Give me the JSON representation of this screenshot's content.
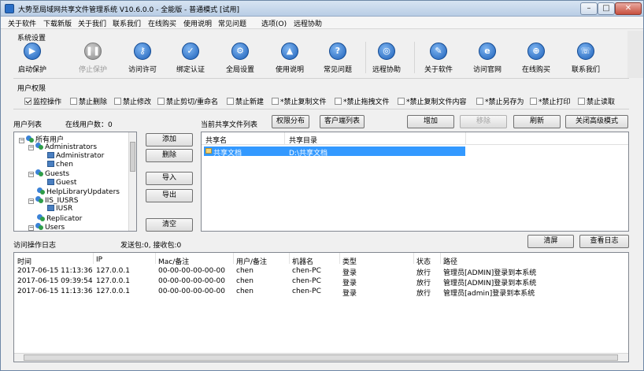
{
  "window": {
    "title": "大势至局域网共享文件管理系统 V10.6.0.0 - 全能版 - 普通模式 [试用]"
  },
  "menu": [
    "关于软件",
    "下载新版",
    "关于我们",
    "联系我们",
    "在线购买",
    "使用说明",
    "常见问题",
    "选项(O)",
    "远程协助"
  ],
  "system_settings": {
    "label": "系统设置",
    "buttons": [
      {
        "label": "启动保护",
        "icon": "play-icon",
        "glyph": "▶",
        "disabled": false
      },
      {
        "label": "停止保护",
        "icon": "pause-icon",
        "glyph": "❚❚",
        "disabled": true
      },
      {
        "label": "访问许可",
        "icon": "key-icon",
        "glyph": "⚷",
        "disabled": false
      },
      {
        "label": "绑定认证",
        "icon": "lock-icon",
        "glyph": "✓",
        "disabled": false
      },
      {
        "label": "全局设置",
        "icon": "gear-icon",
        "glyph": "⚙",
        "disabled": false
      },
      {
        "label": "使用说明",
        "icon": "graduation-cap-icon",
        "glyph": "▲",
        "disabled": false
      },
      {
        "label": "常见问题",
        "icon": "help-icon",
        "glyph": "?",
        "disabled": false
      },
      {
        "label": "远程协助",
        "icon": "remote-assist-icon",
        "glyph": "◎",
        "disabled": false
      },
      {
        "label": "关于软件",
        "icon": "wrench-icon",
        "glyph": "✎",
        "disabled": false
      },
      {
        "label": "访问官网",
        "icon": "browser-icon",
        "glyph": "e",
        "disabled": false
      },
      {
        "label": "在线购买",
        "icon": "cart-icon",
        "glyph": "⊕",
        "disabled": false
      },
      {
        "label": "联系我们",
        "icon": "contact-icon",
        "glyph": "☏",
        "disabled": false
      }
    ]
  },
  "user_permissions": {
    "label": "用户权限",
    "items": [
      {
        "label": "监控操作",
        "checked": true
      },
      {
        "label": "禁止删除",
        "checked": false
      },
      {
        "label": "禁止修改",
        "checked": false
      },
      {
        "label": "禁止剪切/重命名",
        "checked": false
      },
      {
        "label": "禁止新建",
        "checked": false
      },
      {
        "label": "*禁止复制文件",
        "checked": false
      },
      {
        "label": "*禁止拖拽文件",
        "checked": false
      },
      {
        "label": "*禁止复制文件内容",
        "checked": false
      },
      {
        "label": "*禁止另存为",
        "checked": false
      },
      {
        "label": "*禁止打印",
        "checked": false
      },
      {
        "label": "禁止读取",
        "checked": false
      }
    ]
  },
  "user_list": {
    "label": "用户列表",
    "online_label": "在线用户数：0",
    "tree": [
      {
        "label": "所有用户",
        "kind": "group",
        "expander": "−"
      },
      {
        "label": "Administrators",
        "kind": "group",
        "expander": "−"
      },
      {
        "label": "Administrator",
        "kind": "user"
      },
      {
        "label": "chen",
        "kind": "user"
      },
      {
        "label": "Guests",
        "kind": "group",
        "expander": "−"
      },
      {
        "label": "Guest",
        "kind": "user"
      },
      {
        "label": "HelpLibraryUpdaters",
        "kind": "group"
      },
      {
        "label": "IIS_IUSRS",
        "kind": "group",
        "expander": "−"
      },
      {
        "label": "IUSR",
        "kind": "user"
      },
      {
        "label": "Replicator",
        "kind": "group"
      },
      {
        "label": "Users",
        "kind": "group",
        "expander": "−"
      }
    ],
    "buttons": {
      "add": "添加",
      "delete": "删除",
      "import": "导入",
      "export": "导出",
      "clear": "清空"
    }
  },
  "shares": {
    "label": "当前共享文件列表",
    "buttons": {
      "perm_dist": "权限分布",
      "client_list": "客户端列表",
      "add": "增加",
      "remove": "移除",
      "refresh": "刷新",
      "close_adv": "关闭高级模式"
    },
    "columns": [
      "共享名",
      "共享目录"
    ],
    "rows": [
      {
        "name": "共享文档",
        "path": "D:\\共享文档"
      }
    ]
  },
  "log": {
    "label": "访问操作日志",
    "packets": "发送包:0, 接收包:0",
    "buttons": {
      "clear": "清屏",
      "view": "查看日志"
    },
    "columns": [
      "时间",
      "IP",
      "Mac/备注",
      "用户/备注",
      "机器名",
      "类型",
      "状态",
      "路径"
    ],
    "rows": [
      [
        "2017-06-15 11:13:36",
        "127.0.0.1",
        "00-00-00-00-00-00",
        "chen",
        "chen-PC",
        "登录",
        "放行",
        "管理员[ADMIN]登录到本系统"
      ],
      [
        "2017-06-15 09:39:54",
        "127.0.0.1",
        "00-00-00-00-00-00",
        "chen",
        "chen-PC",
        "登录",
        "放行",
        "管理员[ADMIN]登录到本系统"
      ],
      [
        "2017-06-15 11:13:36",
        "127.0.0.1",
        "00-00-00-00-00-00",
        "chen",
        "chen-PC",
        "登录",
        "放行",
        "管理员[admin]登录到本系统"
      ]
    ]
  }
}
